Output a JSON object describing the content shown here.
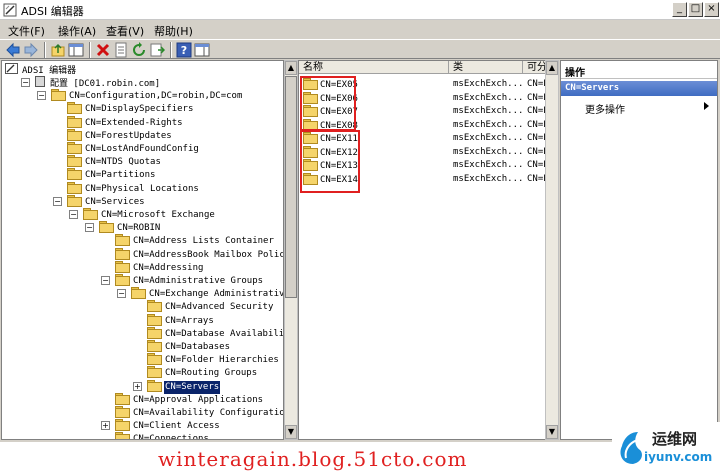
{
  "window": {
    "title": "ADSI 编辑器",
    "minimize": "_",
    "maximize": "□",
    "close": "×"
  },
  "menubar": [
    "文件(F)",
    "操作(A)",
    "查看(V)",
    "帮助(H)"
  ],
  "toolbar": {
    "buttons": [
      "back-icon",
      "forward-icon",
      "up-folder-icon",
      "show-hide-tree-icon",
      "delete-icon",
      "properties-icon",
      "refresh-icon",
      "export-list-icon",
      "help-icon",
      "show-hide-action-pane-icon"
    ]
  },
  "tree": {
    "root": "ADSI 编辑器",
    "nodes": [
      {
        "label": "配置 [DC01.robin.com]",
        "depth": 1,
        "expander": "−",
        "type": "server"
      },
      {
        "label": "CN=Configuration,DC=robin,DC=com",
        "depth": 2,
        "expander": "−"
      },
      {
        "label": "CN=DisplaySpecifiers",
        "depth": 3,
        "expander": ""
      },
      {
        "label": "CN=Extended-Rights",
        "depth": 3,
        "expander": ""
      },
      {
        "label": "CN=ForestUpdates",
        "depth": 3,
        "expander": ""
      },
      {
        "label": "CN=LostAndFoundConfig",
        "depth": 3,
        "expander": ""
      },
      {
        "label": "CN=NTDS Quotas",
        "depth": 3,
        "expander": ""
      },
      {
        "label": "CN=Partitions",
        "depth": 3,
        "expander": ""
      },
      {
        "label": "CN=Physical Locations",
        "depth": 3,
        "expander": ""
      },
      {
        "label": "CN=Services",
        "depth": 3,
        "expander": "−"
      },
      {
        "label": "CN=Microsoft Exchange",
        "depth": 4,
        "expander": "−"
      },
      {
        "label": "CN=ROBIN",
        "depth": 5,
        "expander": "−"
      },
      {
        "label": "CN=Address Lists Container",
        "depth": 6,
        "expander": ""
      },
      {
        "label": "CN=AddressBook Mailbox Policies",
        "depth": 6,
        "expander": ""
      },
      {
        "label": "CN=Addressing",
        "depth": 6,
        "expander": ""
      },
      {
        "label": "CN=Administrative Groups",
        "depth": 6,
        "expander": "−"
      },
      {
        "label": "CN=Exchange Administrative Gro",
        "depth": 7,
        "expander": "−"
      },
      {
        "label": "CN=Advanced Security",
        "depth": 8,
        "expander": ""
      },
      {
        "label": "CN=Arrays",
        "depth": 8,
        "expander": ""
      },
      {
        "label": "CN=Database Availability Gr",
        "depth": 8,
        "expander": ""
      },
      {
        "label": "CN=Databases",
        "depth": 8,
        "expander": ""
      },
      {
        "label": "CN=Folder Hierarchies",
        "depth": 8,
        "expander": ""
      },
      {
        "label": "CN=Routing Groups",
        "depth": 8,
        "expander": ""
      },
      {
        "label": "CN=Servers",
        "depth": 8,
        "expander": "+",
        "selected": true
      },
      {
        "label": "CN=Approval Applications",
        "depth": 6,
        "expander": ""
      },
      {
        "label": "CN=Availability Configuration",
        "depth": 6,
        "expander": ""
      },
      {
        "label": "CN=Client Access",
        "depth": 6,
        "expander": "+"
      },
      {
        "label": "CN=Connections",
        "depth": 6,
        "expander": ""
      }
    ]
  },
  "list": {
    "columns": [
      "名称",
      "类",
      "可分辨"
    ],
    "rows": [
      {
        "name": "CN=EX05",
        "class": "msExchExch...",
        "dn": "CN=EXC"
      },
      {
        "name": "CN=EX06",
        "class": "msExchExch...",
        "dn": "CN=EXC"
      },
      {
        "name": "CN=EX07",
        "class": "msExchExch...",
        "dn": "CN=EXC"
      },
      {
        "name": "CN=EX08",
        "class": "msExchExch...",
        "dn": "CN=EXC"
      },
      {
        "name": "CN=EX11",
        "class": "msExchExch...",
        "dn": "CN=EX1"
      },
      {
        "name": "CN=EX12",
        "class": "msExchExch...",
        "dn": "CN=EX1"
      },
      {
        "name": "CN=EX13",
        "class": "msExchExch...",
        "dn": "CN=EX1"
      },
      {
        "name": "CN=EX14",
        "class": "msExchExch...",
        "dn": "CN=EX1"
      }
    ]
  },
  "actions": {
    "header": "操作",
    "section": "CN=Servers",
    "more": "更多操作"
  },
  "watermark": "winteragain.blog.51cto.com",
  "logo": {
    "cn": "运维网",
    "url": "iyunv.com"
  },
  "colors": {
    "highlight": "#e02020",
    "selection": "#0a246a",
    "action_section": "#3f6cc2"
  }
}
